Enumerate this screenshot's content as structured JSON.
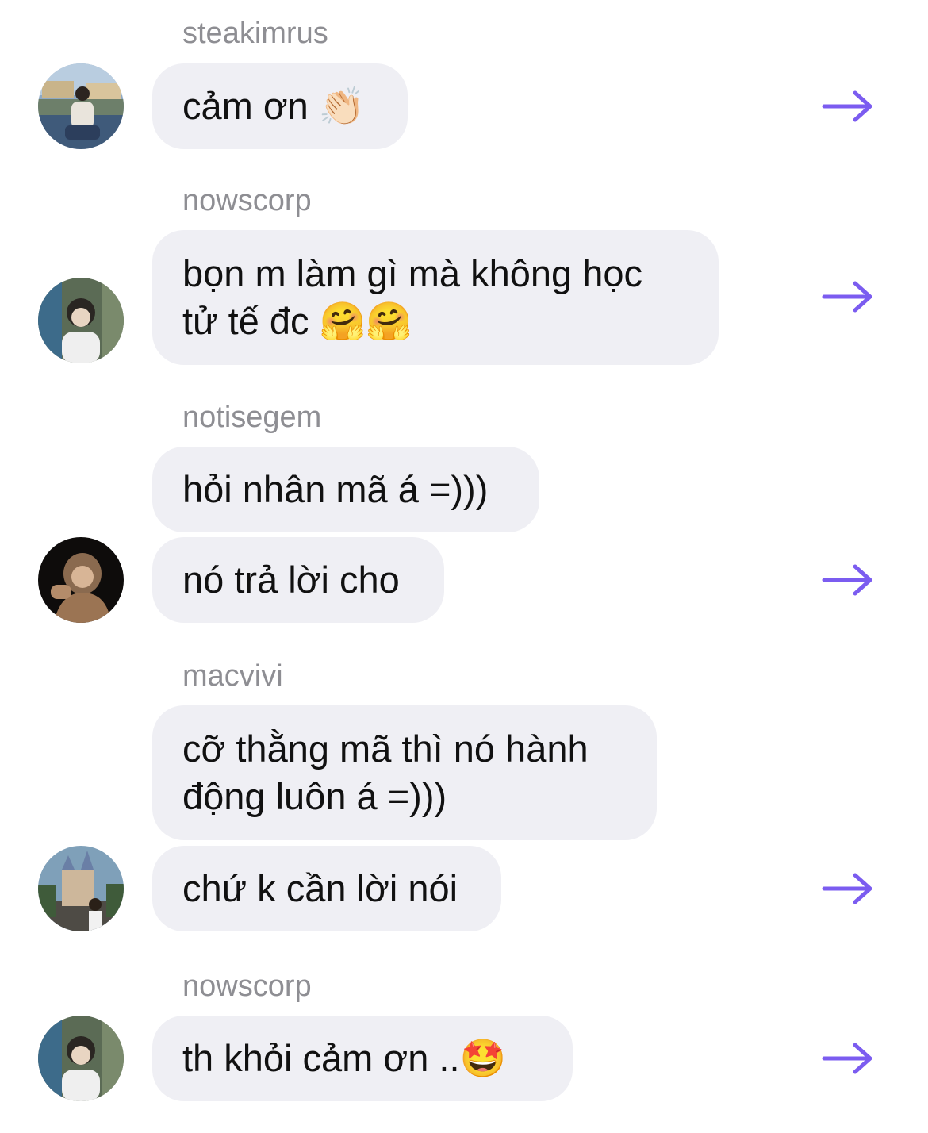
{
  "messages": [
    {
      "username": "steakimrus",
      "bubbles": [
        "cảm ơn 👏🏻"
      ],
      "avatar": "avatar-photo-city"
    },
    {
      "username": "nowscorp",
      "bubbles": [
        "bọn m làm gì mà không học\ntử tế đc 🤗🤗"
      ],
      "avatar": "avatar-photo-boy"
    },
    {
      "username": "notisegem",
      "bubbles": [
        "hỏi nhân mã á =)))",
        "nó trả lời cho"
      ],
      "avatar": "avatar-photo-hood"
    },
    {
      "username": "macvivi",
      "bubbles": [
        "cỡ thằng mã thì nó hành\nđộng luôn á =)))",
        "chứ k cần lời nói"
      ],
      "avatar": "avatar-photo-castle"
    },
    {
      "username": "nowscorp",
      "bubbles": [
        "th khỏi cảm ơn ..🤩"
      ],
      "avatar": "avatar-photo-boy"
    }
  ],
  "icons": {
    "forward": "arrow-right-icon"
  },
  "colors": {
    "accent": "#7b5cf0",
    "bubble": "#efeff4",
    "username": "#8e8e93"
  }
}
